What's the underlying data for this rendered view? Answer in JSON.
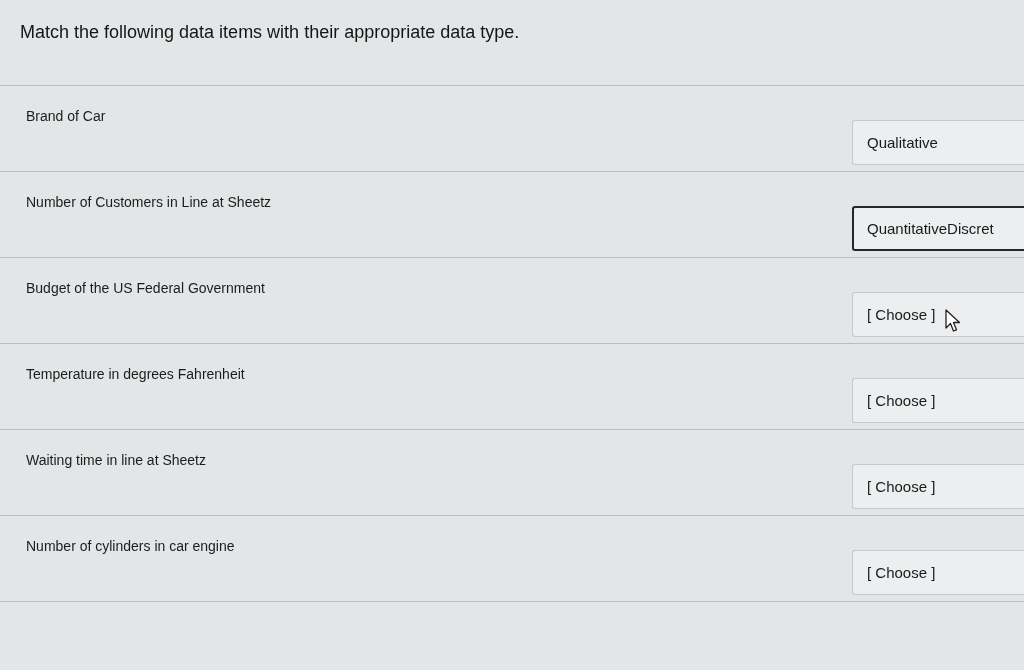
{
  "question": {
    "title": "Match the following data items with their appropriate data type."
  },
  "items": [
    {
      "prompt": "Brand of Car",
      "answer": "Qualitative",
      "focused": false,
      "hovered": false
    },
    {
      "prompt": "Number of Customers in Line at Sheetz",
      "answer": "QuantitativeDiscret",
      "focused": true,
      "hovered": false
    },
    {
      "prompt": "Budget of the US Federal Government",
      "answer": "[ Choose ]",
      "focused": false,
      "hovered": true
    },
    {
      "prompt": "Temperature in degrees Fahrenheit",
      "answer": "[ Choose ]",
      "focused": false,
      "hovered": false
    },
    {
      "prompt": "Waiting time in line at Sheetz",
      "answer": "[ Choose ]",
      "focused": false,
      "hovered": false
    },
    {
      "prompt": "Number of cylinders in car engine",
      "answer": "[ Choose ]",
      "focused": false,
      "hovered": false
    }
  ]
}
